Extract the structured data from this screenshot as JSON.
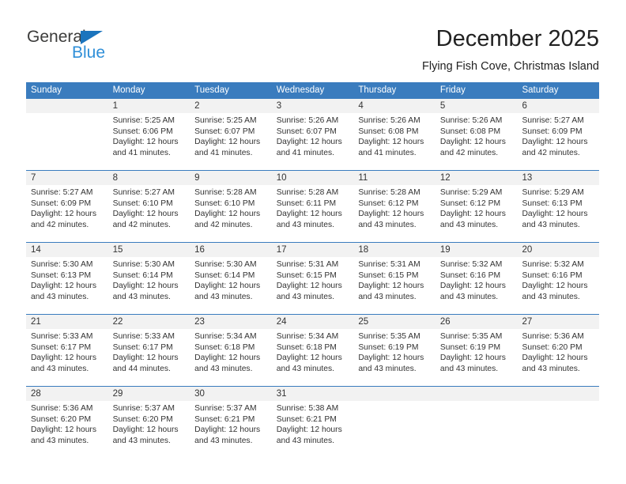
{
  "brand": {
    "name_part1": "General",
    "name_part2": "Blue",
    "triangle_color": "#1b74bd",
    "text_color": "#3c3c3b",
    "blue_text_color": "#2f8fd8"
  },
  "header": {
    "title": "December 2025",
    "subtitle": "Flying Fish Cove, Christmas Island"
  },
  "theme": {
    "header_bar_color": "#3a7cbe",
    "day_number_band_color": "#f2f2f2",
    "body_text_color": "#333333"
  },
  "weekdays": [
    "Sunday",
    "Monday",
    "Tuesday",
    "Wednesday",
    "Thursday",
    "Friday",
    "Saturday"
  ],
  "weeks": [
    [
      {
        "day": "",
        "empty": true,
        "sunrise": "",
        "sunset": "",
        "daylight1": "",
        "daylight2": ""
      },
      {
        "day": "1",
        "sunrise": "Sunrise: 5:25 AM",
        "sunset": "Sunset: 6:06 PM",
        "daylight1": "Daylight: 12 hours",
        "daylight2": "and 41 minutes."
      },
      {
        "day": "2",
        "sunrise": "Sunrise: 5:25 AM",
        "sunset": "Sunset: 6:07 PM",
        "daylight1": "Daylight: 12 hours",
        "daylight2": "and 41 minutes."
      },
      {
        "day": "3",
        "sunrise": "Sunrise: 5:26 AM",
        "sunset": "Sunset: 6:07 PM",
        "daylight1": "Daylight: 12 hours",
        "daylight2": "and 41 minutes."
      },
      {
        "day": "4",
        "sunrise": "Sunrise: 5:26 AM",
        "sunset": "Sunset: 6:08 PM",
        "daylight1": "Daylight: 12 hours",
        "daylight2": "and 41 minutes."
      },
      {
        "day": "5",
        "sunrise": "Sunrise: 5:26 AM",
        "sunset": "Sunset: 6:08 PM",
        "daylight1": "Daylight: 12 hours",
        "daylight2": "and 42 minutes."
      },
      {
        "day": "6",
        "sunrise": "Sunrise: 5:27 AM",
        "sunset": "Sunset: 6:09 PM",
        "daylight1": "Daylight: 12 hours",
        "daylight2": "and 42 minutes."
      }
    ],
    [
      {
        "day": "7",
        "sunrise": "Sunrise: 5:27 AM",
        "sunset": "Sunset: 6:09 PM",
        "daylight1": "Daylight: 12 hours",
        "daylight2": "and 42 minutes."
      },
      {
        "day": "8",
        "sunrise": "Sunrise: 5:27 AM",
        "sunset": "Sunset: 6:10 PM",
        "daylight1": "Daylight: 12 hours",
        "daylight2": "and 42 minutes."
      },
      {
        "day": "9",
        "sunrise": "Sunrise: 5:28 AM",
        "sunset": "Sunset: 6:10 PM",
        "daylight1": "Daylight: 12 hours",
        "daylight2": "and 42 minutes."
      },
      {
        "day": "10",
        "sunrise": "Sunrise: 5:28 AM",
        "sunset": "Sunset: 6:11 PM",
        "daylight1": "Daylight: 12 hours",
        "daylight2": "and 43 minutes."
      },
      {
        "day": "11",
        "sunrise": "Sunrise: 5:28 AM",
        "sunset": "Sunset: 6:12 PM",
        "daylight1": "Daylight: 12 hours",
        "daylight2": "and 43 minutes."
      },
      {
        "day": "12",
        "sunrise": "Sunrise: 5:29 AM",
        "sunset": "Sunset: 6:12 PM",
        "daylight1": "Daylight: 12 hours",
        "daylight2": "and 43 minutes."
      },
      {
        "day": "13",
        "sunrise": "Sunrise: 5:29 AM",
        "sunset": "Sunset: 6:13 PM",
        "daylight1": "Daylight: 12 hours",
        "daylight2": "and 43 minutes."
      }
    ],
    [
      {
        "day": "14",
        "sunrise": "Sunrise: 5:30 AM",
        "sunset": "Sunset: 6:13 PM",
        "daylight1": "Daylight: 12 hours",
        "daylight2": "and 43 minutes."
      },
      {
        "day": "15",
        "sunrise": "Sunrise: 5:30 AM",
        "sunset": "Sunset: 6:14 PM",
        "daylight1": "Daylight: 12 hours",
        "daylight2": "and 43 minutes."
      },
      {
        "day": "16",
        "sunrise": "Sunrise: 5:30 AM",
        "sunset": "Sunset: 6:14 PM",
        "daylight1": "Daylight: 12 hours",
        "daylight2": "and 43 minutes."
      },
      {
        "day": "17",
        "sunrise": "Sunrise: 5:31 AM",
        "sunset": "Sunset: 6:15 PM",
        "daylight1": "Daylight: 12 hours",
        "daylight2": "and 43 minutes."
      },
      {
        "day": "18",
        "sunrise": "Sunrise: 5:31 AM",
        "sunset": "Sunset: 6:15 PM",
        "daylight1": "Daylight: 12 hours",
        "daylight2": "and 43 minutes."
      },
      {
        "day": "19",
        "sunrise": "Sunrise: 5:32 AM",
        "sunset": "Sunset: 6:16 PM",
        "daylight1": "Daylight: 12 hours",
        "daylight2": "and 43 minutes."
      },
      {
        "day": "20",
        "sunrise": "Sunrise: 5:32 AM",
        "sunset": "Sunset: 6:16 PM",
        "daylight1": "Daylight: 12 hours",
        "daylight2": "and 43 minutes."
      }
    ],
    [
      {
        "day": "21",
        "sunrise": "Sunrise: 5:33 AM",
        "sunset": "Sunset: 6:17 PM",
        "daylight1": "Daylight: 12 hours",
        "daylight2": "and 43 minutes."
      },
      {
        "day": "22",
        "sunrise": "Sunrise: 5:33 AM",
        "sunset": "Sunset: 6:17 PM",
        "daylight1": "Daylight: 12 hours",
        "daylight2": "and 44 minutes."
      },
      {
        "day": "23",
        "sunrise": "Sunrise: 5:34 AM",
        "sunset": "Sunset: 6:18 PM",
        "daylight1": "Daylight: 12 hours",
        "daylight2": "and 43 minutes."
      },
      {
        "day": "24",
        "sunrise": "Sunrise: 5:34 AM",
        "sunset": "Sunset: 6:18 PM",
        "daylight1": "Daylight: 12 hours",
        "daylight2": "and 43 minutes."
      },
      {
        "day": "25",
        "sunrise": "Sunrise: 5:35 AM",
        "sunset": "Sunset: 6:19 PM",
        "daylight1": "Daylight: 12 hours",
        "daylight2": "and 43 minutes."
      },
      {
        "day": "26",
        "sunrise": "Sunrise: 5:35 AM",
        "sunset": "Sunset: 6:19 PM",
        "daylight1": "Daylight: 12 hours",
        "daylight2": "and 43 minutes."
      },
      {
        "day": "27",
        "sunrise": "Sunrise: 5:36 AM",
        "sunset": "Sunset: 6:20 PM",
        "daylight1": "Daylight: 12 hours",
        "daylight2": "and 43 minutes."
      }
    ],
    [
      {
        "day": "28",
        "sunrise": "Sunrise: 5:36 AM",
        "sunset": "Sunset: 6:20 PM",
        "daylight1": "Daylight: 12 hours",
        "daylight2": "and 43 minutes."
      },
      {
        "day": "29",
        "sunrise": "Sunrise: 5:37 AM",
        "sunset": "Sunset: 6:20 PM",
        "daylight1": "Daylight: 12 hours",
        "daylight2": "and 43 minutes."
      },
      {
        "day": "30",
        "sunrise": "Sunrise: 5:37 AM",
        "sunset": "Sunset: 6:21 PM",
        "daylight1": "Daylight: 12 hours",
        "daylight2": "and 43 minutes."
      },
      {
        "day": "31",
        "sunrise": "Sunrise: 5:38 AM",
        "sunset": "Sunset: 6:21 PM",
        "daylight1": "Daylight: 12 hours",
        "daylight2": "and 43 minutes."
      },
      {
        "day": "",
        "empty": true,
        "sunrise": "",
        "sunset": "",
        "daylight1": "",
        "daylight2": ""
      },
      {
        "day": "",
        "empty": true,
        "sunrise": "",
        "sunset": "",
        "daylight1": "",
        "daylight2": ""
      },
      {
        "day": "",
        "empty": true,
        "sunrise": "",
        "sunset": "",
        "daylight1": "",
        "daylight2": ""
      }
    ]
  ]
}
